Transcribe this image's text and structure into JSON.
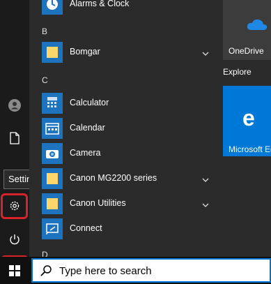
{
  "rail": {
    "tooltip": "Settings",
    "icons": [
      "user-icon",
      "document-icon",
      "settings-icon",
      "power-icon"
    ]
  },
  "app_list": {
    "top_item": "Alarms & Clock",
    "groups": [
      {
        "letter": "B",
        "items": [
          {
            "name": "Bomgar",
            "expandable": true
          }
        ]
      },
      {
        "letter": "C",
        "items": [
          {
            "name": "Calculator",
            "expandable": false
          },
          {
            "name": "Calendar",
            "expandable": false
          },
          {
            "name": "Camera",
            "expandable": false
          },
          {
            "name": "Canon MG2200 series",
            "expandable": true
          },
          {
            "name": "Canon Utilities",
            "expandable": true
          },
          {
            "name": "Connect",
            "expandable": false
          }
        ]
      },
      {
        "letter": "D",
        "items": []
      }
    ]
  },
  "tiles": {
    "onedrive_label": "OneDrive",
    "group_label": "Explore",
    "edge_label": "Microsoft Edge"
  },
  "taskbar": {
    "search_placeholder": "Type here to search"
  },
  "colors": {
    "accent": "#0078d7",
    "highlight": "#d6232c",
    "folder": "#ffd66b"
  }
}
